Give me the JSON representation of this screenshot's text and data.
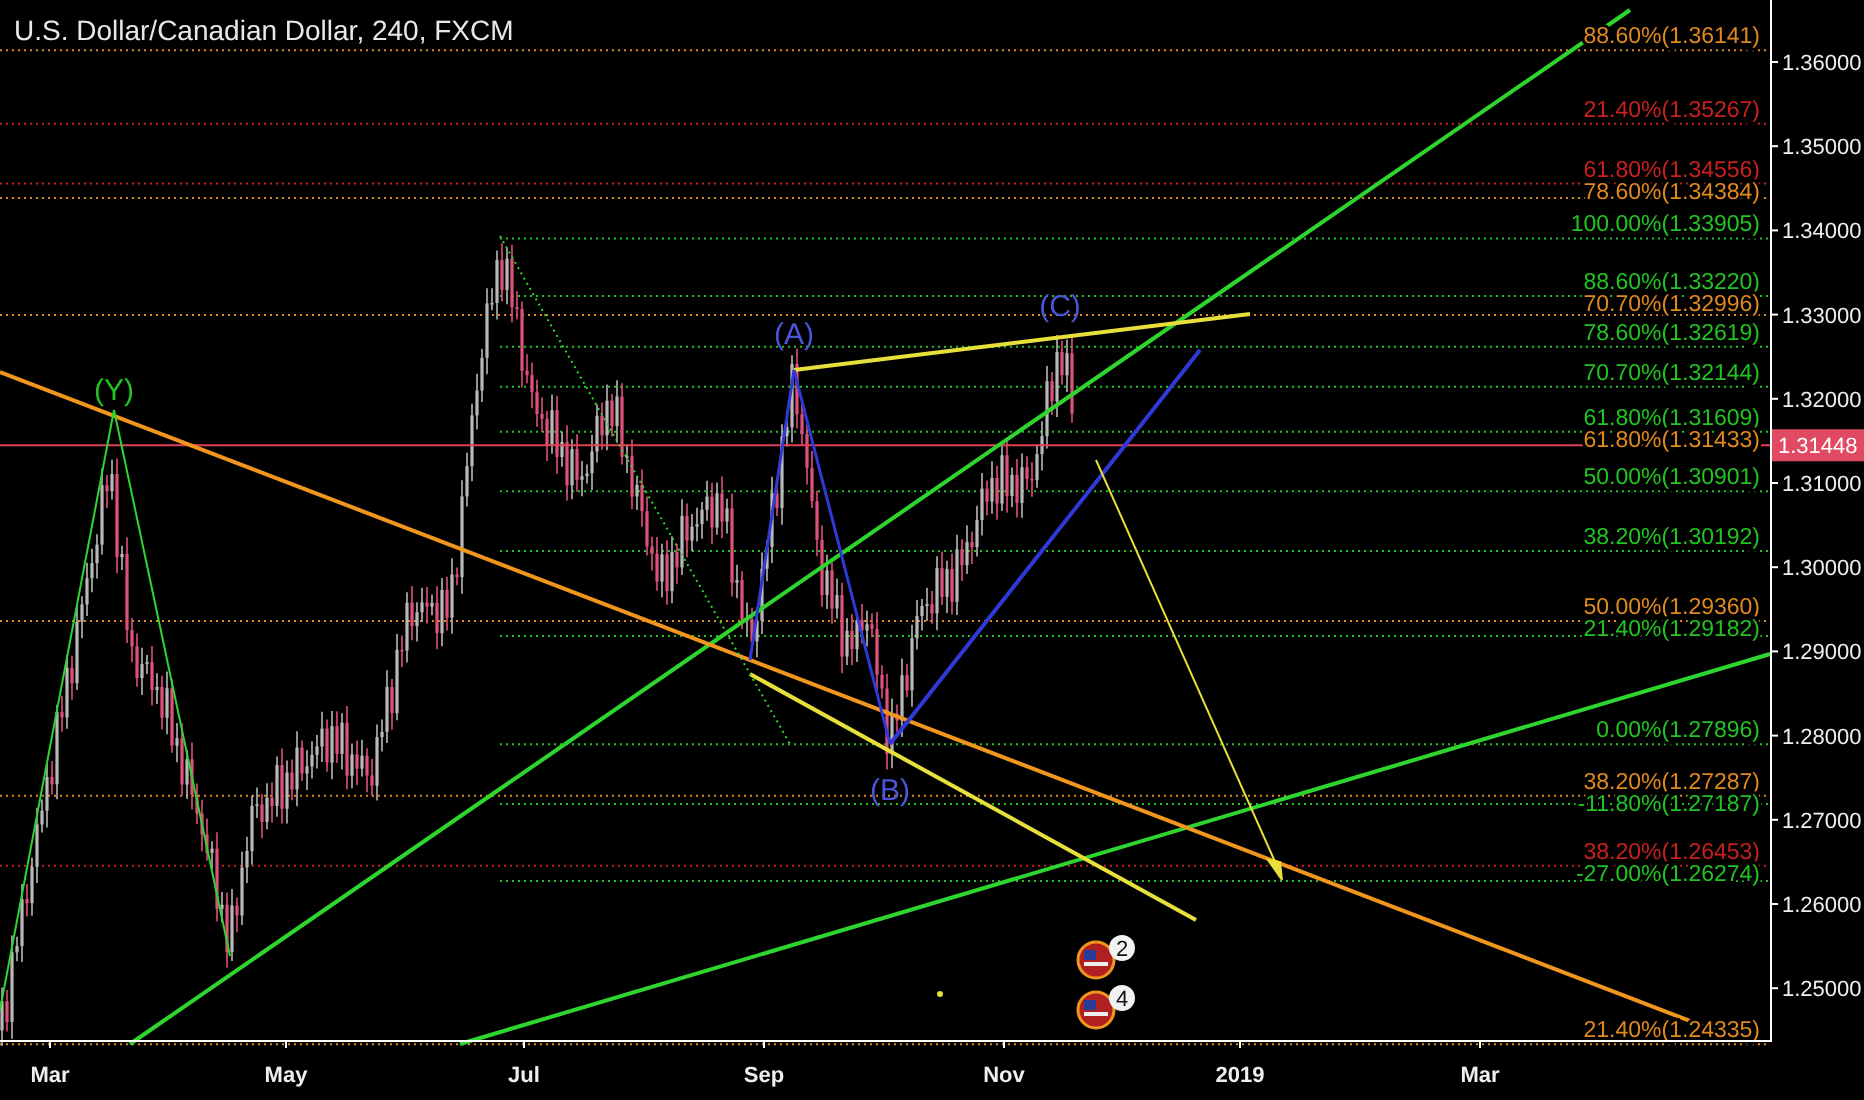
{
  "chart": {
    "title": "U.S. Dollar/Canadian Dollar, 240, FXCM",
    "price_axis": [
      "1.36000",
      "1.35000",
      "1.34000",
      "1.33000",
      "1.32000",
      "1.31000",
      "1.30000",
      "1.29000",
      "1.28000",
      "1.27000",
      "1.26000",
      "1.25000"
    ],
    "time_axis": [
      "Mar",
      "May",
      "Jul",
      "Sep",
      "Nov",
      "2019",
      "Mar"
    ],
    "current_price": "1.31448",
    "fib_levels": [
      {
        "label": "88.60%(1.36141)",
        "color": "#e0891e"
      },
      {
        "label": "21.40%(1.35267)",
        "color": "#c8201e"
      },
      {
        "label": "61.80%(1.34556)",
        "color": "#c8201e"
      },
      {
        "label": "78.60%(1.34384)",
        "color": "#e0891e"
      },
      {
        "label": "100.00%(1.33905)",
        "color": "#22c322"
      },
      {
        "label": "88.60%(1.33220)",
        "color": "#22c322"
      },
      {
        "label": "70.70%(1.32996)",
        "color": "#e0891e"
      },
      {
        "label": "78.60%(1.32619)",
        "color": "#22c322"
      },
      {
        "label": "70.70%(1.32144)",
        "color": "#22c322"
      },
      {
        "label": "61.80%(1.31609)",
        "color": "#22c322"
      },
      {
        "label": "61.80%(1.31433)",
        "color": "#e0891e"
      },
      {
        "label": "50.00%(1.30901)",
        "color": "#22c322"
      },
      {
        "label": "38.20%(1.30192)",
        "color": "#22c322"
      },
      {
        "label": "50.00%(1.29360)",
        "color": "#e0891e"
      },
      {
        "label": "21.40%(1.29182)",
        "color": "#22c322"
      },
      {
        "label": "0.00%(1.27896)",
        "color": "#22c322"
      },
      {
        "label": "38.20%(1.27287)",
        "color": "#e0891e"
      },
      {
        "label": "-11.80%(1.27187)",
        "color": "#22c322"
      },
      {
        "label": "38.20%(1.26453)",
        "color": "#c8201e"
      },
      {
        "label": "-27.00%(1.26274)",
        "color": "#22c322"
      },
      {
        "label": "21.40%(1.24335)",
        "color": "#e0891e"
      }
    ],
    "wave_labels": [
      {
        "label": "(Y)",
        "color": "#22c322"
      },
      {
        "label": "(A)",
        "color": "#4a55d8"
      },
      {
        "label": "(B)",
        "color": "#4a55d8"
      },
      {
        "label": "(C)",
        "color": "#4a55d8"
      }
    ],
    "events": [
      {
        "count": "2"
      },
      {
        "count": "4"
      }
    ]
  }
}
